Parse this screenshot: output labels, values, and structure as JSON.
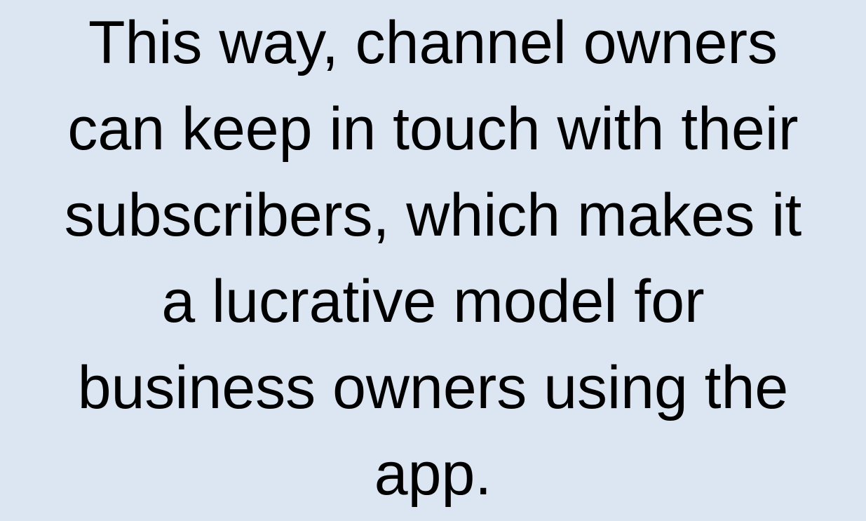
{
  "slide": {
    "lines": [
      "This way, channel owners",
      "can keep in touch with their",
      "subscribers, which makes it",
      "a lucrative model for",
      "business owners using the",
      "app."
    ],
    "colors": {
      "background": "#dce6f2",
      "text": "#000000"
    }
  }
}
